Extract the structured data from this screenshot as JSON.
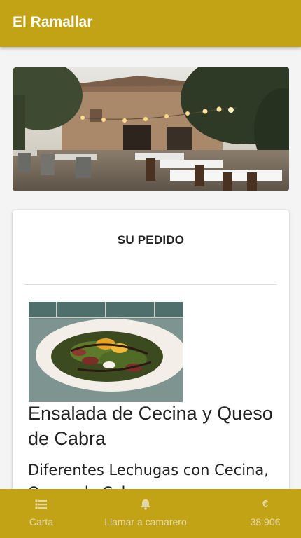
{
  "header": {
    "title": "El Ramallar"
  },
  "order": {
    "title": "SU PEDIDO",
    "item": {
      "name": "Ensalada de Cecina y Queso de Cabra",
      "description": "Diferentes Lechugas con Cecina, Queso de Cabra"
    }
  },
  "bottom_nav": {
    "items": [
      {
        "label": "Carta",
        "icon": "list-icon"
      },
      {
        "label": "Llamar a camarero",
        "icon": "bell-icon"
      },
      {
        "label": "38.90€",
        "icon": "euro-icon"
      }
    ]
  },
  "colors": {
    "brand": "#c3a316",
    "nav_text": "#e6d8a6",
    "background": "#f4f4f4"
  }
}
